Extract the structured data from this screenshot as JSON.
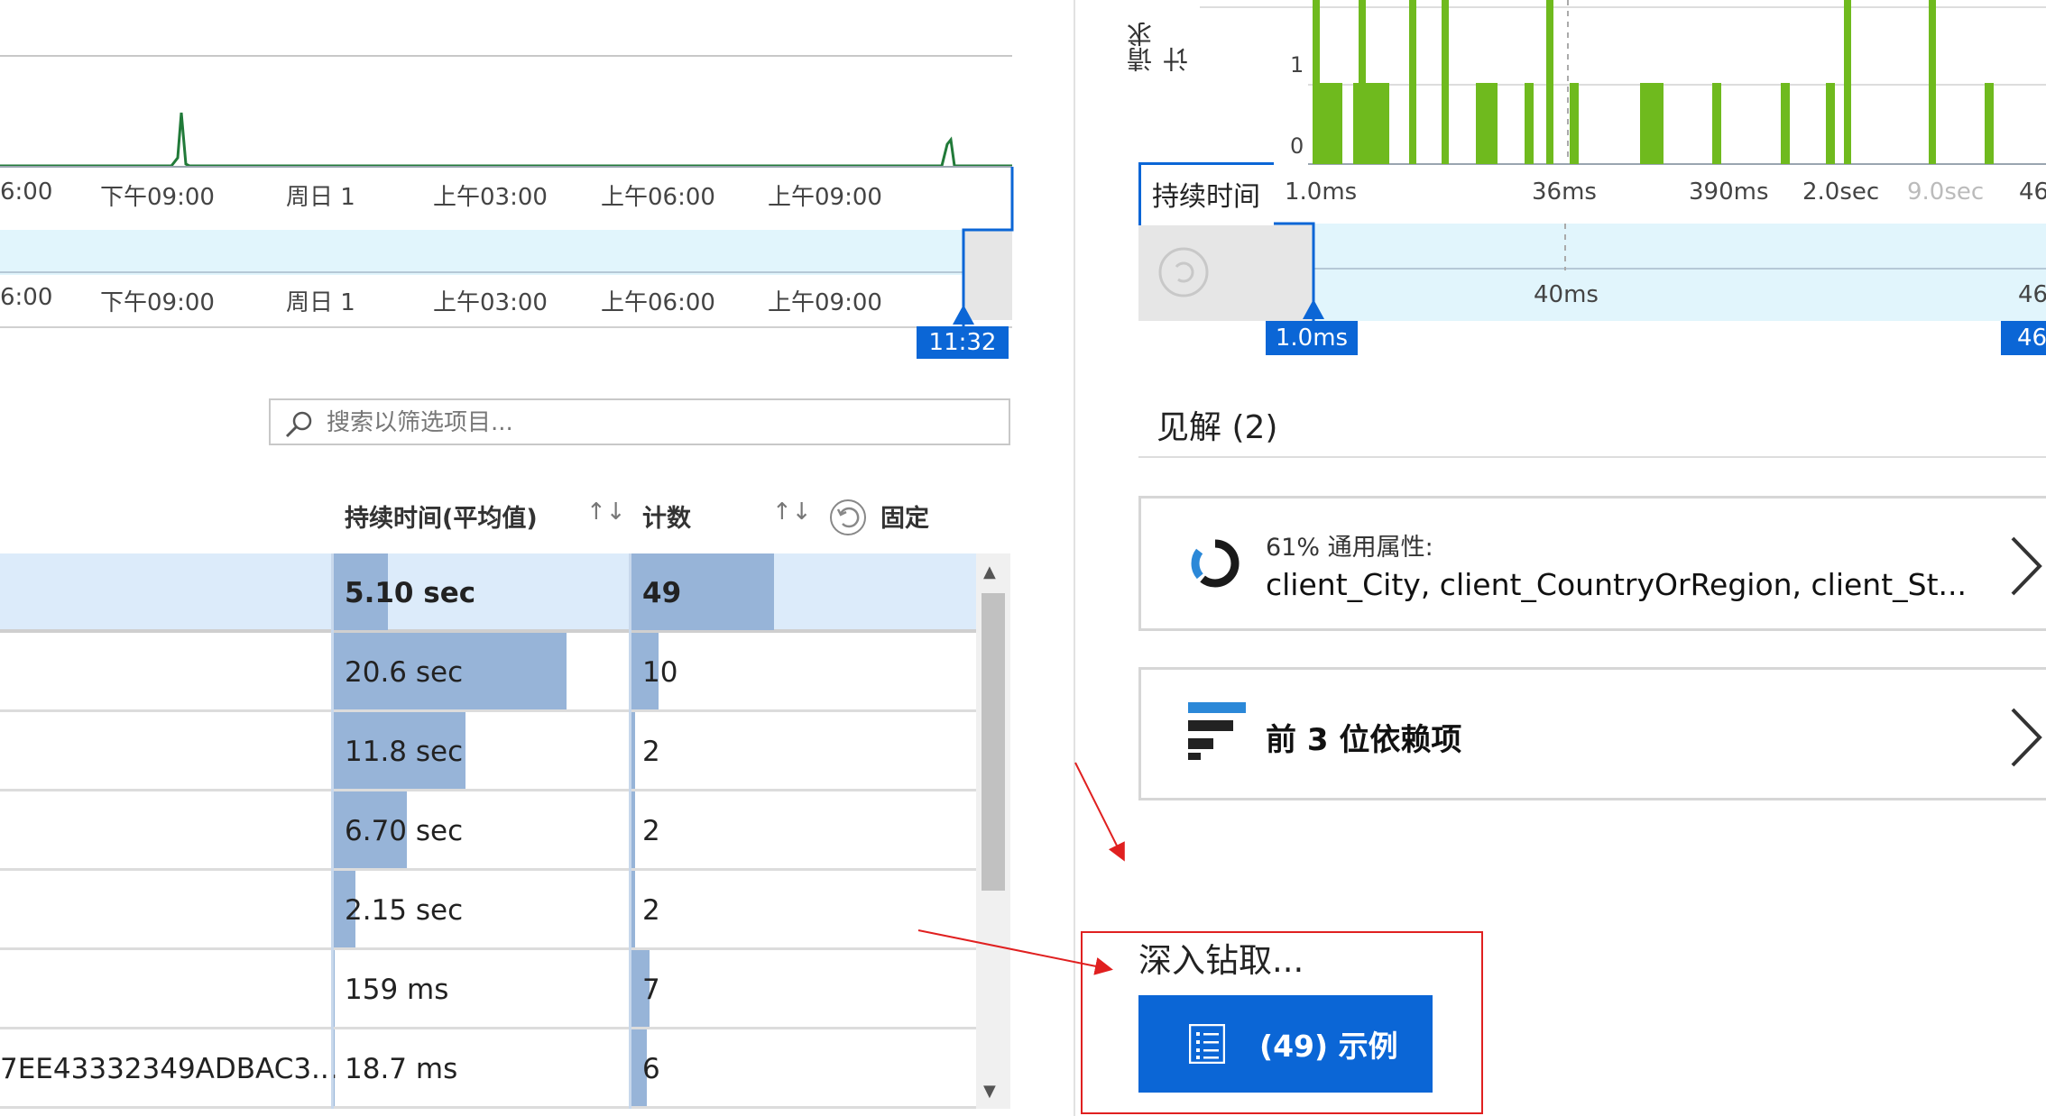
{
  "timeline": {
    "ticks_top": [
      "6:00",
      "下午09:00",
      "周日 1",
      "上午03:00",
      "上午06:00",
      "上午09:00"
    ],
    "ticks_bottom": [
      "6:00",
      "下午09:00",
      "周日 1",
      "上午03:00",
      "上午06:00",
      "上午09:00"
    ],
    "handle_time": "11:32"
  },
  "search": {
    "placeholder": "搜索以筛选项目..."
  },
  "table": {
    "columns": {
      "duration": "持续时间(平均值)",
      "count": "计数",
      "pin": "固定"
    },
    "sort_icon": "↑↓",
    "rows": [
      {
        "name": "",
        "duration": "5.10 sec",
        "duration_fraction": 0.24,
        "count": "49",
        "count_fraction": 1.0,
        "selected": true
      },
      {
        "name": "",
        "duration": "20.6 sec",
        "duration_fraction": 1.0,
        "count": "10",
        "count_fraction": 0.2,
        "selected": false
      },
      {
        "name": "",
        "duration": "11.8 sec",
        "duration_fraction": 0.57,
        "count": "2",
        "count_fraction": 0.04,
        "selected": false
      },
      {
        "name": "",
        "duration": "6.70 sec",
        "duration_fraction": 0.32,
        "count": "2",
        "count_fraction": 0.04,
        "selected": false
      },
      {
        "name": "",
        "duration": "2.15 sec",
        "duration_fraction": 0.1,
        "count": "2",
        "count_fraction": 0.04,
        "selected": false
      },
      {
        "name": "",
        "duration": "159 ms",
        "duration_fraction": 0.01,
        "count": "7",
        "count_fraction": 0.14,
        "selected": false
      },
      {
        "name": "7EE43332349ADBAC3...",
        "duration": "18.7 ms",
        "duration_fraction": 0.005,
        "count": "6",
        "count_fraction": 0.12,
        "selected": false
      }
    ]
  },
  "histogram": {
    "y_label": "请求计",
    "y_ticks": [
      "1",
      "0"
    ],
    "duration_tab": "持续时间",
    "x_ticks": [
      "1.0ms",
      "36ms",
      "390ms",
      "2.0sec",
      "9.0sec",
      "46"
    ],
    "brush_mid": "40ms",
    "brush_right": "46",
    "handle_left": "1.0ms",
    "handle_right": "46",
    "bar_color": "#6fba1e"
  },
  "insights": {
    "title": "见解 (2)",
    "attrs_line1": "61% 通用属性:",
    "attrs_line2": "client_City, client_CountryOrRegion, client_St...",
    "deps_label": "前 3 位依赖项"
  },
  "drill": {
    "title": "深入钻取...",
    "samples_button": "(49) 示例"
  },
  "colors": {
    "accent": "#0b66d6",
    "bar": "#97b4d8",
    "annotation": "#e02020"
  }
}
